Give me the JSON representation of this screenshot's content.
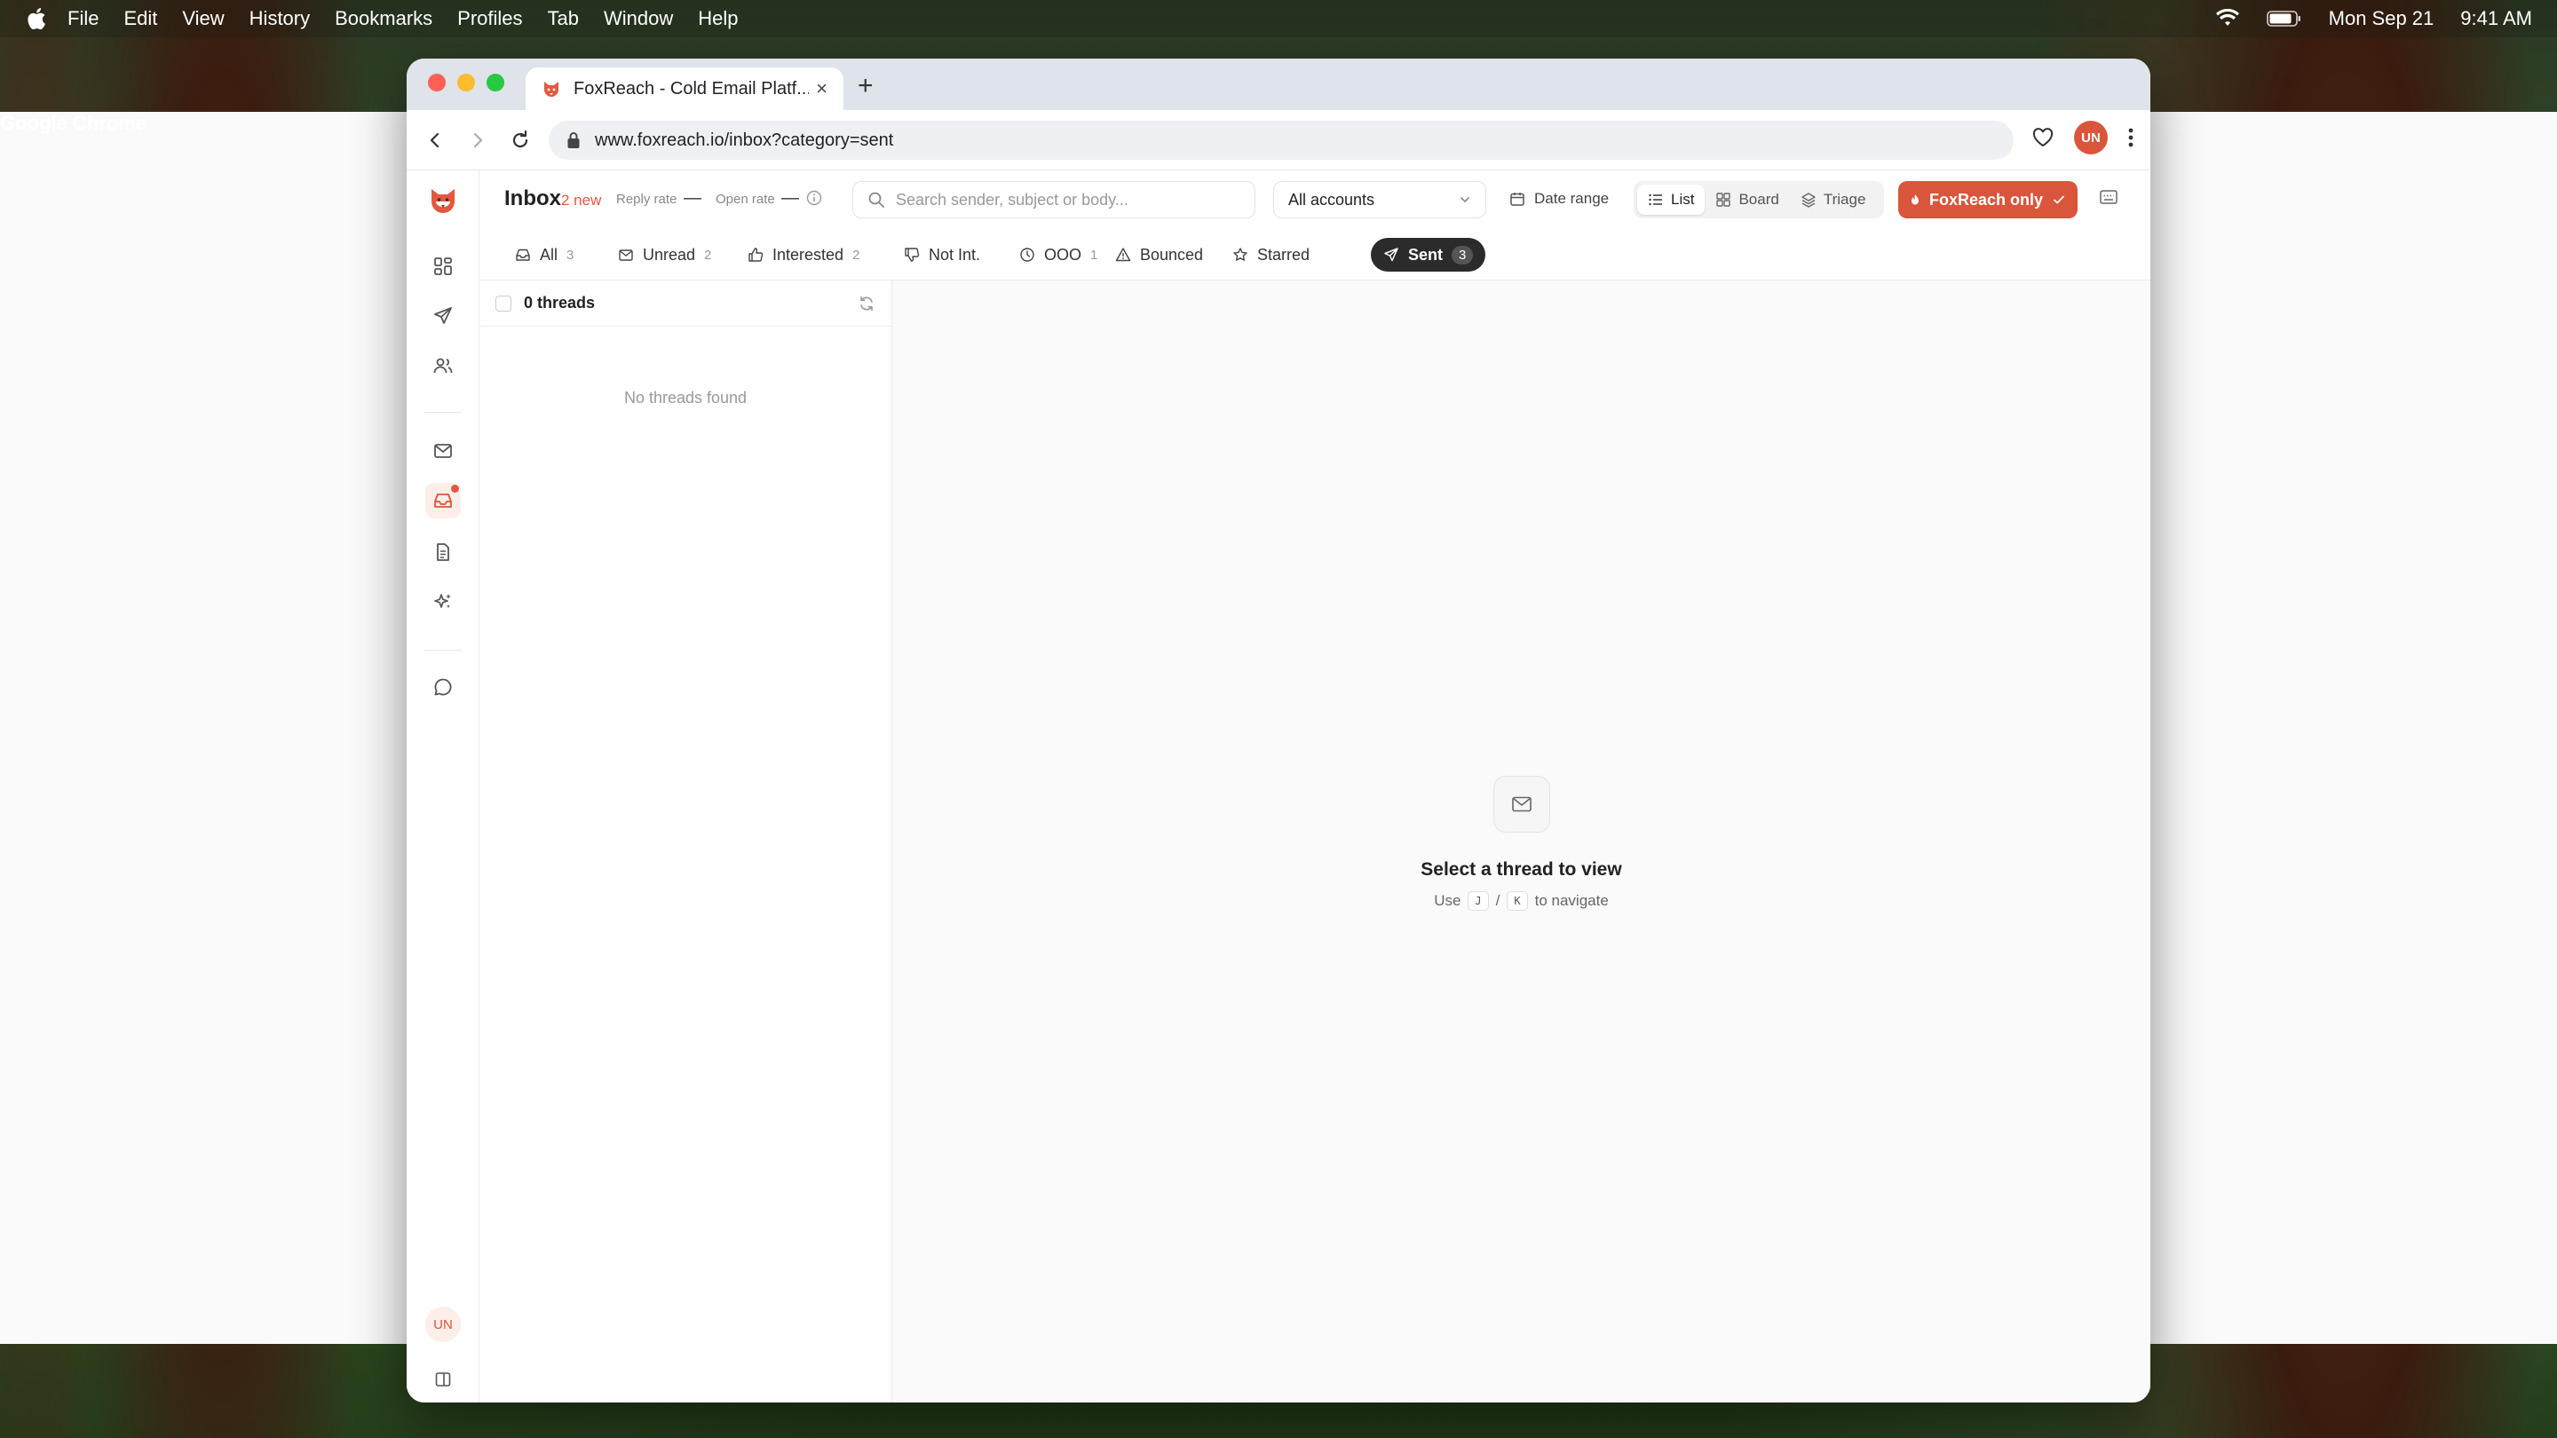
{
  "menubar": {
    "app": "Google Chrome",
    "items": [
      "File",
      "Edit",
      "View",
      "History",
      "Bookmarks",
      "Profiles",
      "Tab",
      "Window",
      "Help"
    ],
    "date": "Mon Sep 21",
    "time": "9:41 AM"
  },
  "browser": {
    "tab_title": "FoxReach - Cold Email Platf...",
    "url": "www.foxreach.io/inbox?category=sent",
    "profile_initials": "UN"
  },
  "header": {
    "title": "Inbox",
    "new_badge": "2 new",
    "reply_rate_label": "Reply rate",
    "reply_rate_value": "—",
    "open_rate_label": "Open rate",
    "open_rate_value": "—",
    "search_placeholder": "Search sender, subject or body...",
    "accounts_label": "All accounts",
    "date_range_label": "Date range",
    "views": [
      "List",
      "Board",
      "Triage"
    ],
    "active_view": "List",
    "fox_button": "FoxReach only"
  },
  "filters": [
    {
      "label": "All",
      "count": "3"
    },
    {
      "label": "Unread",
      "count": "2"
    },
    {
      "label": "Interested",
      "count": "2"
    },
    {
      "label": "Not Int.",
      "count": ""
    },
    {
      "label": "OOO",
      "count": "1"
    },
    {
      "label": "Bounced",
      "count": ""
    },
    {
      "label": "Starred",
      "count": ""
    },
    {
      "label": "Sent",
      "count": "3"
    }
  ],
  "thread_list": {
    "count_label": "0 threads",
    "empty_text": "No threads found"
  },
  "reader": {
    "title": "Select a thread to view",
    "hint_prefix": "Use",
    "key_j": "J",
    "key_sep": "/",
    "key_k": "K",
    "hint_suffix": "to navigate"
  },
  "sidebar": {
    "user_initials": "UN"
  },
  "colors": {
    "accent": "#d9553b",
    "selected_chip": "#2b2b2b"
  }
}
